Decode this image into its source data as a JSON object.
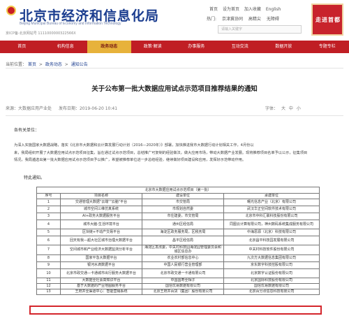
{
  "header": {
    "site_title": "北京市经济和信息化局",
    "site_subtitle_en": "Beijing  Municipal Bureau of Economy and Information Technology",
    "site_subtitle_en2": "",
    "icp": "京ICP备-北京网站号 1111000000322566X",
    "top_links": [
      "首页",
      "设为首页",
      "加入收藏",
      "English"
    ],
    "top_links2": [
      "热门:",
      "京津冀协同",
      "高精尖",
      "无障碍"
    ],
    "search_placeholder": "请输入关键字",
    "seal_text": "走进首都"
  },
  "nav": {
    "items": [
      "首页",
      "机构信息",
      "政务动态",
      "政策·解读",
      "办事服务",
      "互动交流",
      "数据开放",
      "专题专栏"
    ],
    "active_index": 2
  },
  "breadcrumb": {
    "prefix": "当前位置：",
    "items": [
      "首页",
      "政务动态",
      "通知公告"
    ]
  },
  "article": {
    "title": "关于公布第一批大数据应用试点示范项目推荐结果的通知",
    "source": "来源：大数据应用产业处",
    "date": "发布日期：2019-06-20 10:41",
    "font_label": "字体：",
    "font_sizes": [
      "大",
      "中",
      "小"
    ],
    "greeting": "各有关单位：",
    "paragraph_lines": [
      "为深入实施国家大数据战略，落实《北京市大数据和云计算发展行动计划（2016—2020年）》部署，加快推进我市大数据行动计划相关工作，4月份以",
      "来，我局组织开展了大数据应用试点示范项目征集，旨在通过试点示范项目，总结推广可复制的经验做法，做大应用市场，带动大数据产业发展。现将推荐项目名单予以公示，征集项目",
      "情况，我局遴选出第一批大数据应用试点示范项目予以推广，希望被推荐单位进一步总结经验，继续做好项目建设和应用，发挥好示范带动作用。"
    ],
    "notice": "特此通知。"
  },
  "table": {
    "caption": "北京市大数据应用试点示范项目（第一批）",
    "headers": [
      "序号",
      "项目名称",
      "建设单位",
      "承建单位"
    ],
    "rows": [
      [
        "1",
        "交通管理大数据\"云端\"\"云脑\"平台",
        "市交管局",
        "曙光信息产业（北京）有限公司"
      ],
      [
        "2",
        "城市空间三维仿真系统",
        "市规划自然委",
        "武汉华正空间软件技术有限公司"
      ],
      [
        "3",
        "AI+政务大数据服务平台",
        "市住建委，市交管局",
        "北京市中科汇联科技股份有限公司"
      ],
      [
        "4",
        "城市大脑-生活环境平台",
        "通州区经信局",
        "同图云计算有限公司，神州数码系统集成服务有限公司"
      ],
      [
        "5",
        "区块链+不动产交易平台",
        "海淀区政务服务局，区税务局",
        "中海思源（北京）科技有限公司"
      ],
      [
        "6",
        "回天有我—超大社区城市治理大数据平台",
        "昌平区经信局",
        "北京昌平科技园发展有限公司"
      ],
      [
        "7",
        "空间城市和产业经济大数据监测分析平台",
        "海淀区发改委，中关村科技园海淀园管理委员会和城区信息办",
        "中关村科技软件股份有限公司"
      ],
      [
        "8",
        "国家平急大数据平台",
        "农业农村部信息中心",
        "九次方大数据信息集团有限公司"
      ],
      [
        "9",
        "银河水滴数据平台",
        "中国人民银行营业管理部",
        "京东数字科技控股有限公司"
      ],
      [
        "10",
        "北京市政交通—卡通城市出行服务大数据平台",
        "北京市政交通一卡通有限公司",
        "北京数字认证股份有限公司"
      ],
      [
        "11",
        "大数据全社会高知识平台",
        "中国国寿全相子",
        "北京国际科技股份有限公司"
      ],
      [
        "12",
        "基于大数据的产业地图服务平台",
        "国信优易数据有限公司",
        "国信优易数据有限公司"
      ],
      [
        "13",
        "王府井全渠道中心：智能营销系统",
        "北京王府井百货（集团）股份有限公司",
        "北京百分点信息科技有限公司"
      ]
    ],
    "highlighted_row": "12"
  },
  "colors": {
    "brand_red": "#c01e24",
    "nav_active": "#e7b23b",
    "title_blue": "#1b3d8f",
    "highlight": "#d4262c"
  }
}
